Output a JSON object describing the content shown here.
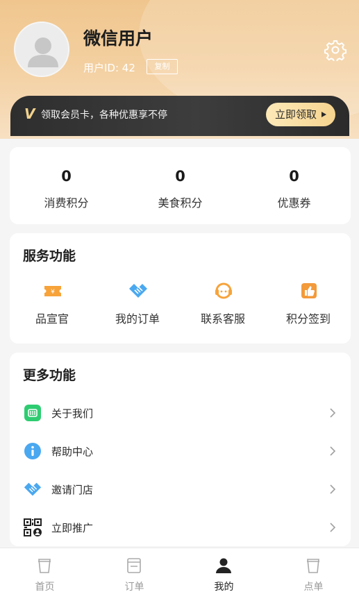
{
  "profile": {
    "name": "微信用户",
    "user_id": "用户ID: 42",
    "copy_label": "复制"
  },
  "vip": {
    "logo": "V",
    "text": "领取会员卡，各种优惠享不停",
    "button_label": "立即领取"
  },
  "stats": [
    {
      "value": "0",
      "label": "消费积分"
    },
    {
      "value": "0",
      "label": "美食积分"
    },
    {
      "value": "0",
      "label": "优惠券"
    }
  ],
  "services": {
    "title": "服务功能",
    "items": [
      {
        "label": "品宣官",
        "icon": "ticket-icon"
      },
      {
        "label": "我的订单",
        "icon": "handshake-icon"
      },
      {
        "label": "联系客服",
        "icon": "headset-icon"
      },
      {
        "label": "积分签到",
        "icon": "thumbs-up-icon"
      }
    ]
  },
  "more": {
    "title": "更多功能",
    "items": [
      {
        "label": "关于我们",
        "icon": "chat-icon"
      },
      {
        "label": "帮助中心",
        "icon": "info-icon"
      },
      {
        "label": "邀请门店",
        "icon": "handshake-icon"
      },
      {
        "label": "立即推广",
        "icon": "qrcode-icon"
      }
    ]
  },
  "tabbar": [
    {
      "label": "首页",
      "icon": "cup-icon",
      "active": false
    },
    {
      "label": "订单",
      "icon": "order-icon",
      "active": false
    },
    {
      "label": "我的",
      "icon": "user-icon",
      "active": true
    },
    {
      "label": "点单",
      "icon": "cup-icon",
      "active": false
    }
  ],
  "colors": {
    "header_gold": "#f0c68e",
    "vip_dark": "#2e2e2e",
    "accent_orange": "#f7a33a",
    "accent_blue": "#4aa8f0",
    "accent_green": "#2ecc71"
  }
}
